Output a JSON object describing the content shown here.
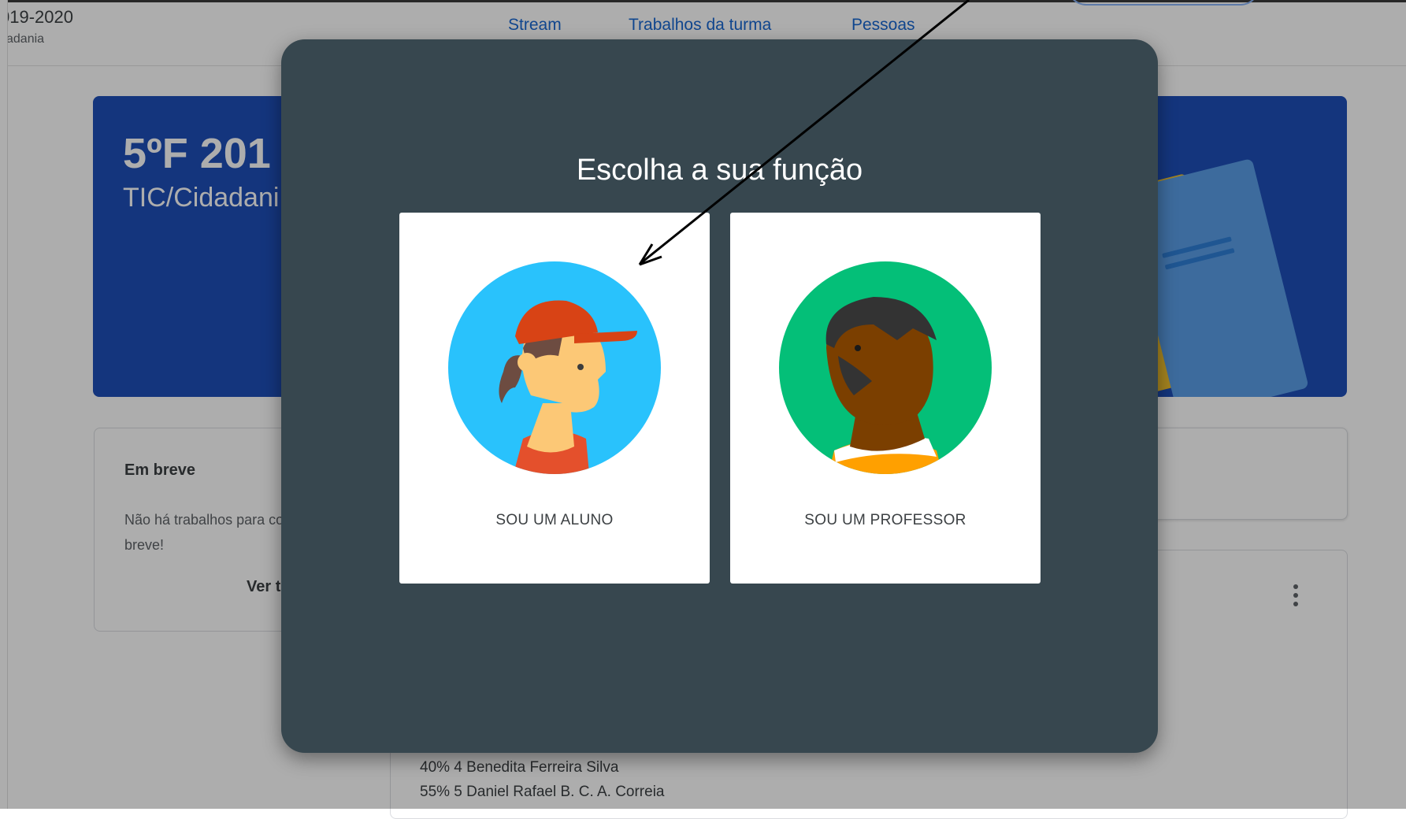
{
  "header": {
    "class_title": "019-2020",
    "class_subtitle": "adania",
    "tabs": [
      {
        "label": "Stream"
      },
      {
        "label": "Trabalhos da turma"
      },
      {
        "label": "Pessoas"
      }
    ]
  },
  "banner": {
    "title": "5ºF 201",
    "subtitle": "TIC/Cidadani",
    "color": "#1e4eb8"
  },
  "upcoming": {
    "title": "Em breve",
    "text": "Não há trabalhos para concluir em breve!",
    "link": "Ver t"
  },
  "list": [
    "40% 4 Benedita Ferreira Silva",
    "55% 5 Daniel Rafael B. C. A. Correia"
  ],
  "modal": {
    "title": "Escolha a sua função",
    "student_label": "SOU UM ALUNO",
    "teacher_label": "SOU UM PROFESSOR",
    "student_icon": "student-avatar-icon",
    "teacher_icon": "teacher-avatar-icon"
  },
  "colors": {
    "modal_bg": "#37474f",
    "student_circle": "#29c2fc",
    "teacher_circle": "#04bf78",
    "tab_text": "#1967d2"
  }
}
